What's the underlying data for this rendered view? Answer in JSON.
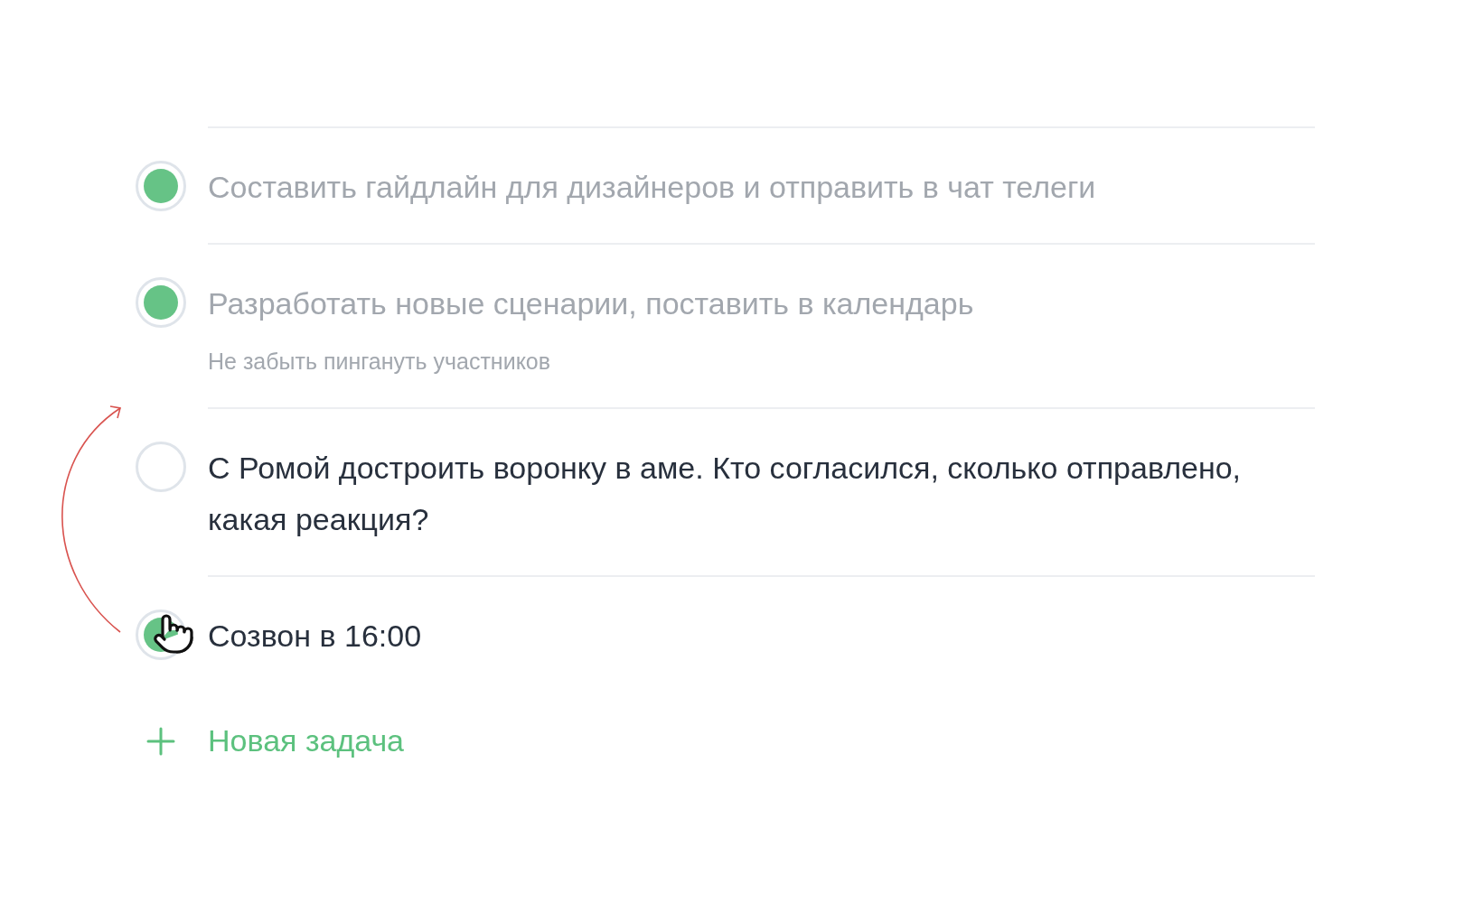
{
  "tasks": [
    {
      "title": "Составить гайдлайн для дизайнеров и отправить в чат телеги",
      "checked": true,
      "greyed": true
    },
    {
      "title": "Разработать новые сценарии, поставить в календарь",
      "note": "Не забыть пингануть участников",
      "checked": true,
      "greyed": true
    },
    {
      "title": "С Ромой достроить воронку в аме. Кто согласился, сколько отправлено, какая реакция?",
      "checked": false,
      "greyed": false
    },
    {
      "title": "Созвон в 16:00",
      "checked": true,
      "greyed": false
    }
  ],
  "new_task": {
    "label": "Новая задача"
  }
}
